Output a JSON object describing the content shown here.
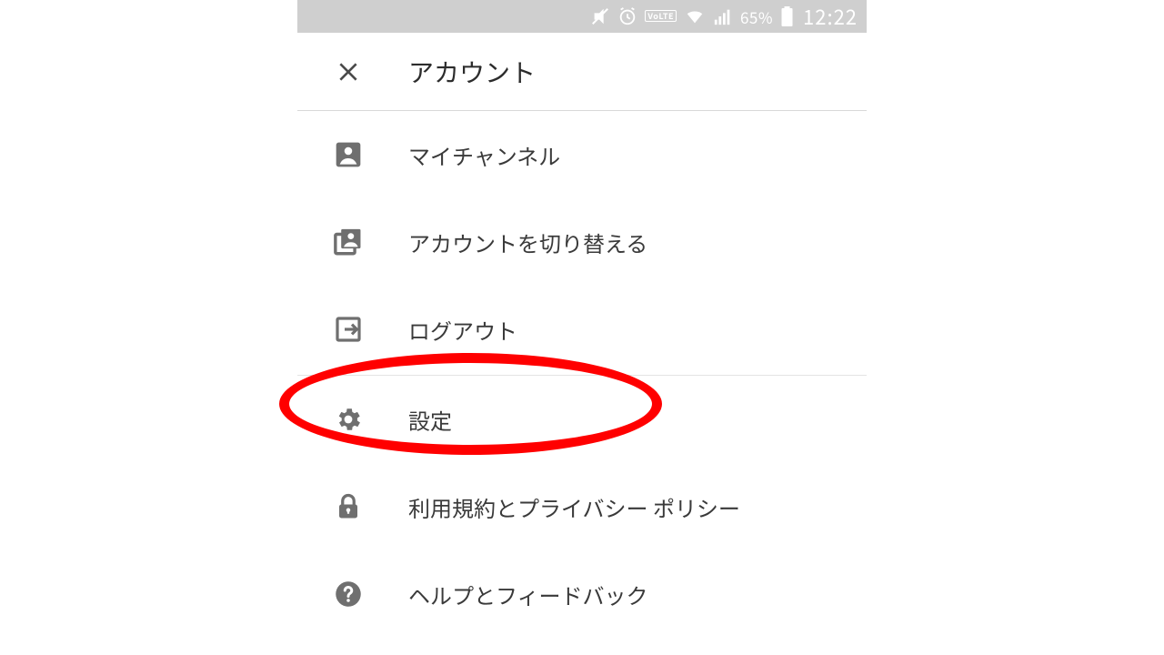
{
  "status": {
    "volte": "VoLTE",
    "battery_pct": "65%",
    "clock": "12:22"
  },
  "header": {
    "title": "アカウント"
  },
  "menu": {
    "my_channel": "マイチャンネル",
    "switch_account": "アカウントを切り替える",
    "logout": "ログアウト",
    "settings": "設定",
    "terms": "利用規約とプライバシー ポリシー",
    "help": "ヘルプとフィードバック"
  }
}
